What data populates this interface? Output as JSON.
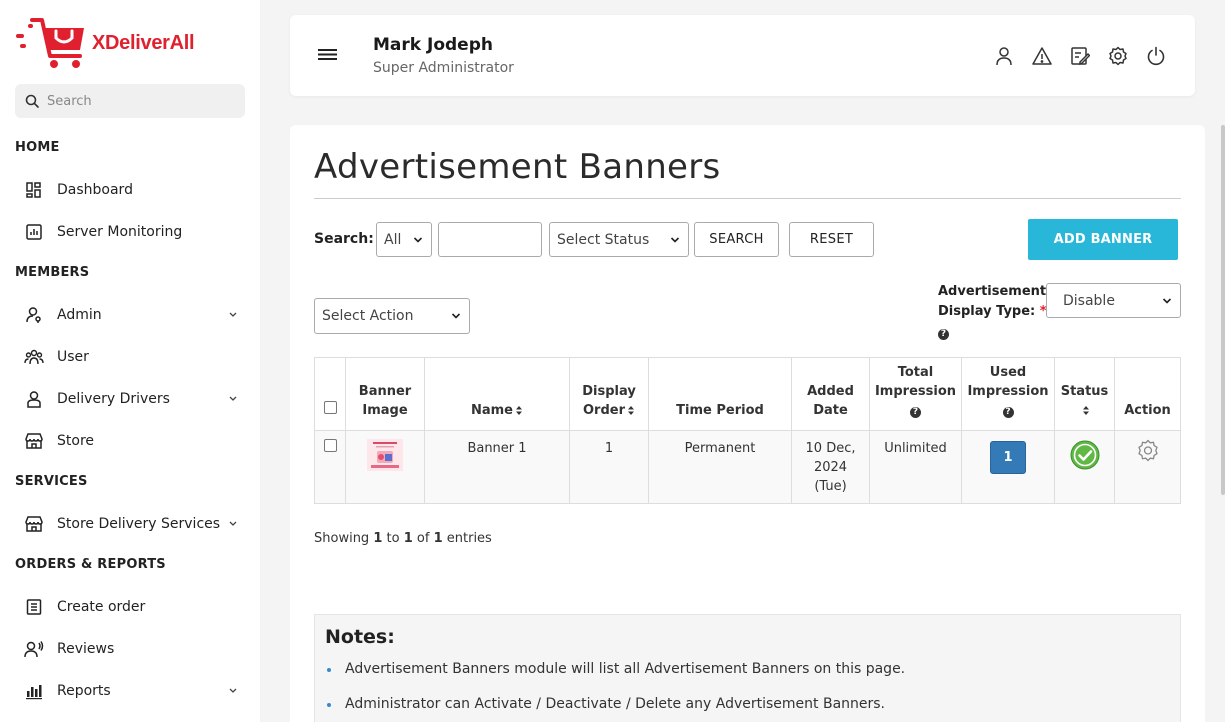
{
  "brand": {
    "name": "XDeliverAll",
    "accent": "#e0202e"
  },
  "sidebar": {
    "search_placeholder": "Search",
    "sections": {
      "home": "HOME",
      "members": "MEMBERS",
      "services": "SERVICES",
      "orders": "ORDERS & REPORTS"
    },
    "items": {
      "dashboard": "Dashboard",
      "server_monitoring": "Server Monitoring",
      "admin": "Admin",
      "user": "User",
      "delivery_drivers": "Delivery Drivers",
      "store": "Store",
      "store_delivery_services": "Store Delivery Services",
      "create_order": "Create order",
      "reviews": "Reviews",
      "reports": "Reports"
    }
  },
  "header": {
    "user_name": "Mark Jodeph",
    "user_role": "Super Administrator",
    "icons": [
      "user-icon",
      "warning-icon",
      "edit-note-icon",
      "settings-icon",
      "power-icon"
    ]
  },
  "page": {
    "title": "Advertisement Banners",
    "search_label": "Search:",
    "filter_all": "All",
    "search_value": "",
    "status_placeholder": "Select Status",
    "search_button": "SEARCH",
    "reset_button": "RESET",
    "add_button": "ADD BANNER",
    "action_placeholder": "Select Action",
    "display_type_label_1": "Advertisement",
    "display_type_label_2": "Display Type:",
    "display_type_required": "*",
    "display_type_value": "Disable",
    "primary_color": "#28b7d8"
  },
  "table": {
    "headers": {
      "banner_image": "Banner Image",
      "name": "Name",
      "display_order": "Display Order",
      "time_period": "Time Period",
      "added_date": "Added Date",
      "total_impression": "Total Impression",
      "used_impression": "Used Impression",
      "status": "Status",
      "action": "Action"
    },
    "rows": [
      {
        "name": "Banner 1",
        "display_order": "1",
        "time_period": "Permanent",
        "added_date_1": "10 Dec,",
        "added_date_2": "2024",
        "added_date_3": "(Tue)",
        "total_impression": "Unlimited",
        "used_impression": "1"
      }
    ]
  },
  "pagination": {
    "prefix": "Showing",
    "from": "1",
    "to_word": "to",
    "to": "1",
    "of_word": "of",
    "total": "1",
    "suffix": "entries"
  },
  "notes": {
    "title": "Notes:",
    "items": [
      "Advertisement Banners module will list all Advertisement Banners on this page.",
      "Administrator can Activate / Deactivate / Delete any Advertisement Banners."
    ]
  }
}
